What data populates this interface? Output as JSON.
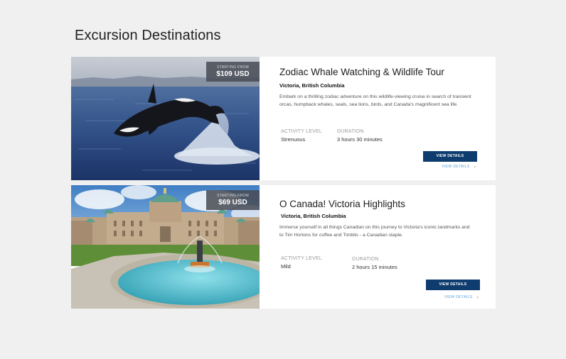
{
  "page": {
    "title": "Excursion Destinations"
  },
  "excursions": [
    {
      "price_label": "STARTING FROM",
      "price": "$109 USD",
      "title": "Zodiac Whale Watching & Wildlife Tour",
      "location": "Victoria, British Columbia",
      "description": "Embark on a thrilling zodiac adventure on this wildlife-viewing cruise in search of transient orcas, humpback whales, seals, sea lions, birds, and Canada's magnificent sea life.",
      "activity_label": "ACTIVITY LEVEL",
      "activity_value": "Strenuous",
      "duration_label": "DURATION",
      "duration_value": "3 hours 30 minutes",
      "button_label": "VIEW DETAILS",
      "link_label": "VIEW DETAILS",
      "link_icon": "chevron-right-icon"
    },
    {
      "price_label": "STARTING FROM",
      "price": "$69 USD",
      "title": "O Canada! Victoria Highlights",
      "location": "Victoria, British Columbia",
      "description": "Immerse yourself in all things Canadian on this journey to Victoria's iconic landmarks and to Tim Hortons for coffee and Timbits - a Canadian staple.",
      "activity_label": "ACTIVITY LEVEL",
      "activity_value": "Mild",
      "duration_label": "DURATION",
      "duration_value": "2 hours 15 minutes",
      "button_label": "VIEW DETAILS",
      "link_label": "VIEW DETAILS",
      "link_icon": "chevron-right-icon"
    }
  ],
  "colors": {
    "background": "#f0f0f0",
    "card": "#ffffff",
    "primary_button": "#0f3c6e",
    "link": "#5b9fd6",
    "price_tag": "#464a54"
  }
}
